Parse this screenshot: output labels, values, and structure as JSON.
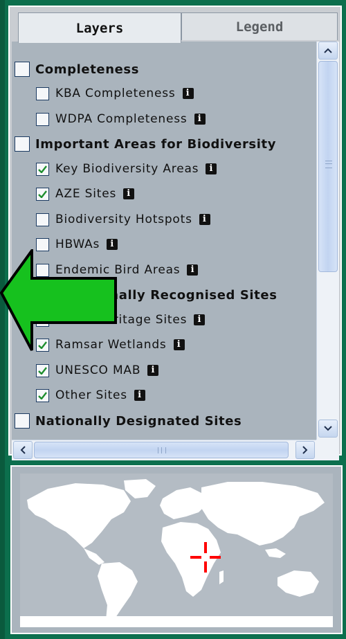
{
  "tabs": {
    "layers": "Layers",
    "legend": "Legend"
  },
  "groups": {
    "completeness": {
      "label": "Completeness",
      "items": [
        "KBA Completeness",
        "WDPA Completeness"
      ]
    },
    "important_areas": {
      "label": "Important Areas for Biodiversity",
      "items": [
        "Key Biodiversity Areas",
        "AZE Sites",
        "Biodiversity Hotspots",
        "HBWAs",
        "Endemic Bird Areas"
      ]
    },
    "intl_sites": {
      "label": "Internationally Recognised Sites",
      "items": [
        "World Heritage Sites",
        "Ramsar Wetlands",
        "UNESCO MAB",
        "Other Sites"
      ]
    },
    "national_sites": {
      "label": "Nationally Designated Sites"
    }
  },
  "info_glyph": "i",
  "icons": [
    "info-icon",
    "checkmark-icon",
    "scroll-up-icon",
    "scroll-down-icon",
    "scroll-left-icon",
    "scroll-right-icon",
    "crosshair-icon"
  ],
  "colors": {
    "panel_border": "#ffffff",
    "background": "#0c6f4d",
    "arrow": "#16c11e",
    "crosshair": "#ff0000",
    "check": "#1e8e2e"
  }
}
